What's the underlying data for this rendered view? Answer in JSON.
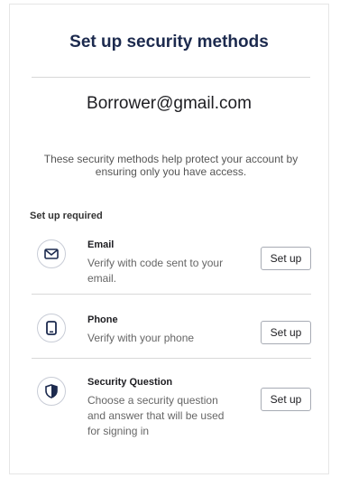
{
  "page": {
    "title": "Set up security methods",
    "account_email": "Borrower@gmail.com",
    "description": "These security methods help protect your account by ensuring only you have access.",
    "section_label": "Set up required"
  },
  "methods": [
    {
      "title": "Email",
      "description": "Verify with code sent to your email.",
      "button_label": "Set up",
      "icon": "envelope-icon"
    },
    {
      "title": "Phone",
      "description": "Verify with your phone",
      "button_label": "Set up",
      "icon": "phone-icon"
    },
    {
      "title": "Security Question",
      "description": "Choose a security question and answer that will be used for signing in",
      "button_label": "Set up",
      "icon": "shield-icon"
    }
  ],
  "colors": {
    "title": "#1c2a4e",
    "icon": "#1c2a4e",
    "divider": "#d8d8d8"
  }
}
